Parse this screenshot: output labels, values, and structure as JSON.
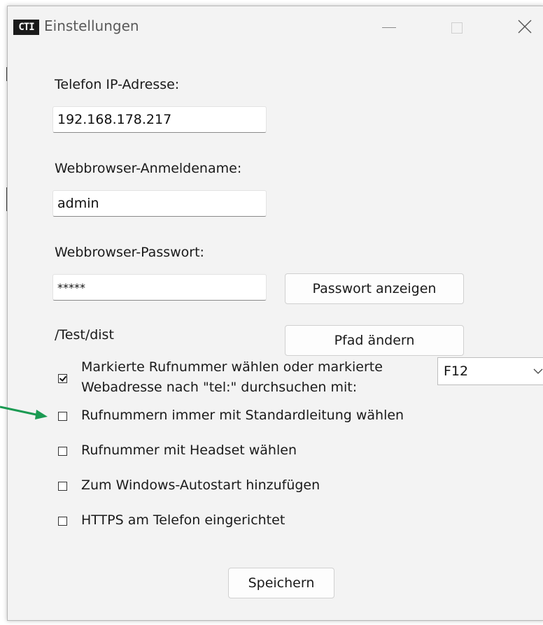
{
  "window": {
    "app_icon_text": "CTI",
    "title": "Einstellungen"
  },
  "form": {
    "ip_label": "Telefon IP-Adresse:",
    "ip_value": "192.168.178.217",
    "user_label": "Webbrowser-Anmeldename:",
    "user_value": "admin",
    "password_label": "Webbrowser-Passwort:",
    "password_value": "*****",
    "show_password_button": "Passwort anzeigen",
    "path_text": "/Test/dist",
    "change_path_button": "Pfad ändern"
  },
  "options": {
    "mark_dial_line1": "Markierte Rufnummer wählen oder markierte",
    "mark_dial_line2": "Webadresse nach \"tel:\" durchsuchen mit:",
    "mark_dial_checked": true,
    "hotkey_selected": "F12",
    "standard_line": "Rufnummern immer mit Standardleitung wählen",
    "standard_line_checked": false,
    "headset": "Rufnummer mit Headset wählen",
    "headset_checked": false,
    "autostart": "Zum Windows-Autostart hinzufügen",
    "autostart_checked": false,
    "https": "HTTPS am Telefon eingerichtet",
    "https_checked": false
  },
  "actions": {
    "save_button": "Speichern"
  },
  "annotation": {
    "arrow_color": "#1a9a52"
  }
}
